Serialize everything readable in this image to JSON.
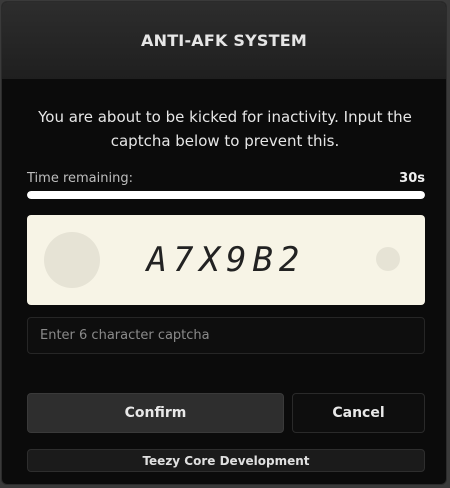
{
  "dialog": {
    "title": "ANTI-AFK SYSTEM",
    "message": "You are about to be kicked for inactivity. Input the captcha below to prevent this.",
    "timer": {
      "label": "Time remaining:",
      "value": "30s",
      "progress_fraction": 1.0
    },
    "captcha": {
      "code": "A7X9B2"
    },
    "input": {
      "value": "",
      "placeholder": "Enter 6 character captcha"
    },
    "buttons": {
      "confirm_label": "Confirm",
      "cancel_label": "Cancel"
    },
    "footer": {
      "text": "Teezy Core Development"
    }
  },
  "colors": {
    "background": "#0b0b0b",
    "header": "#2d2d2d",
    "captcha_bg": "#f7f4e6",
    "progress_fill": "#ffffff",
    "confirm_bg": "#2e2e2e"
  }
}
